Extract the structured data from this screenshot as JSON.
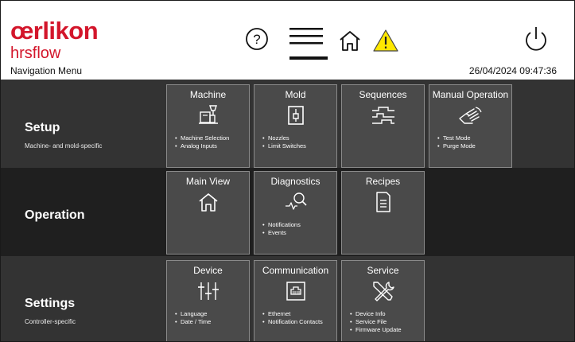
{
  "header": {
    "brand": "œrlikon",
    "brand_sub": "hrsflow",
    "menu_title": "Navigation Menu",
    "datetime": "26/04/2024 09:47:36",
    "accent_color": "#d3162b"
  },
  "rows": [
    {
      "title": "Setup",
      "subtitle": "Machine- and mold-specific",
      "tiles": [
        {
          "title": "Machine",
          "icon": "machine-icon",
          "items": [
            "Machine Selection",
            "Analog Inputs"
          ]
        },
        {
          "title": "Mold",
          "icon": "mold-icon",
          "items": [
            "Nozzles",
            "Limit Switches"
          ]
        },
        {
          "title": "Sequences",
          "icon": "sequences-icon",
          "items": []
        },
        {
          "title": "Manual Operation",
          "icon": "hand-icon",
          "items": [
            "Test Mode",
            "Purge Mode"
          ]
        }
      ]
    },
    {
      "title": "Operation",
      "subtitle": "",
      "tiles": [
        {
          "title": "Main View",
          "icon": "home-icon",
          "items": []
        },
        {
          "title": "Diagnostics",
          "icon": "diagnostics-icon",
          "items": [
            "Notifications",
            "Events"
          ]
        },
        {
          "title": "Recipes",
          "icon": "recipe-icon",
          "items": []
        }
      ]
    },
    {
      "title": "Settings",
      "subtitle": "Controller-specific",
      "tiles": [
        {
          "title": "Device",
          "icon": "sliders-icon",
          "items": [
            "Language",
            "Date / Time"
          ]
        },
        {
          "title": "Communication",
          "icon": "network-port-icon",
          "items": [
            "Ethernet",
            "Notification Contacts"
          ]
        },
        {
          "title": "Service",
          "icon": "tools-icon",
          "items": [
            "Device Info",
            "Service File",
            "Firmware Update"
          ]
        }
      ]
    }
  ]
}
